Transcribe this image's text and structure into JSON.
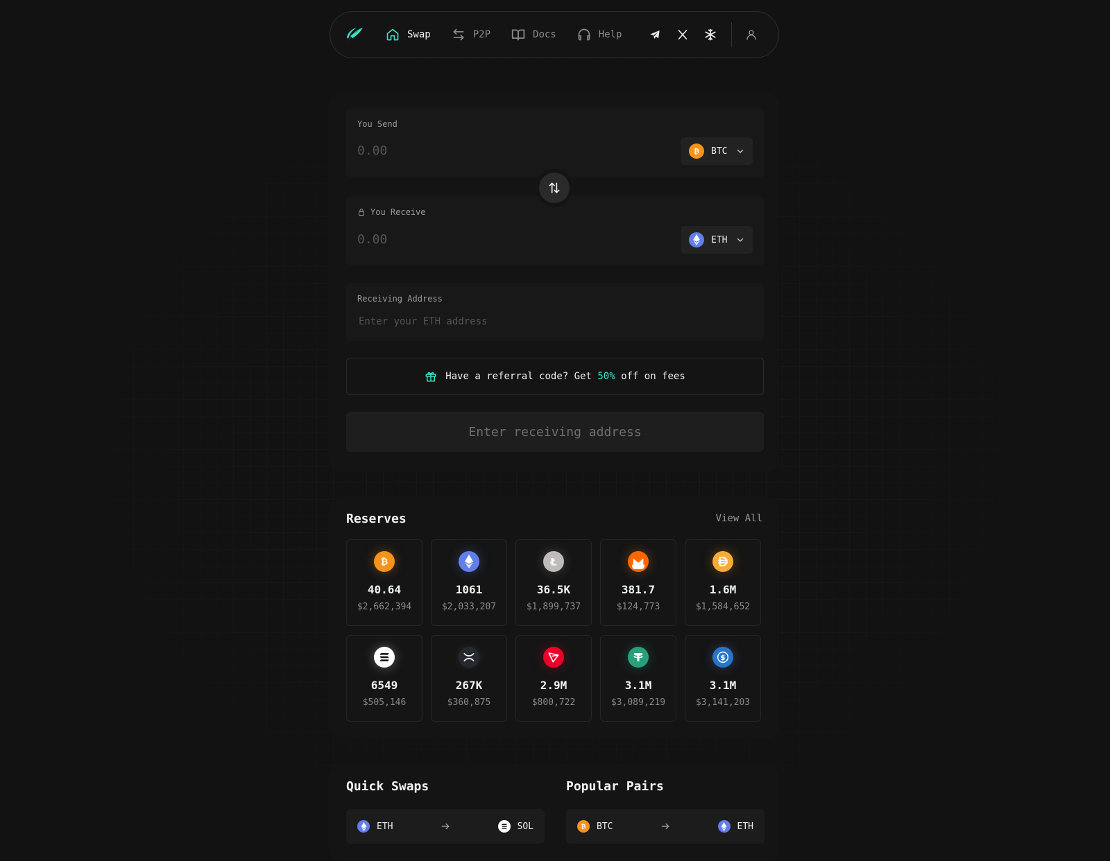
{
  "nav": {
    "items": [
      {
        "label": "Swap",
        "icon": "home-icon",
        "active": true
      },
      {
        "label": "P2P",
        "icon": "arrows-exchange-icon",
        "active": false
      },
      {
        "label": "Docs",
        "icon": "book-icon",
        "active": false
      },
      {
        "label": "Help",
        "icon": "headphones-icon",
        "active": false
      }
    ],
    "social": [
      "telegram-icon",
      "x-icon",
      "snowflake-icon"
    ]
  },
  "swap": {
    "send_label": "You Send",
    "send_amount": "0.00",
    "send_coin": "BTC",
    "receive_label": "You Receive",
    "receive_amount": "0.00",
    "receive_coin": "ETH",
    "address_label": "Receiving Address",
    "address_placeholder": "Enter your ETH address",
    "referral_prefix": "Have a referral code? Get",
    "referral_highlight": "50%",
    "referral_suffix": "off on fees",
    "submit_label": "Enter receiving address"
  },
  "reserves": {
    "title": "Reserves",
    "view_all": "View All",
    "items": [
      {
        "coin": "BTC",
        "amount": "40.64",
        "usd": "$2,662,394",
        "color": "#f7931a"
      },
      {
        "coin": "ETH",
        "amount": "1061",
        "usd": "$2,033,207",
        "color": "#627eea"
      },
      {
        "coin": "LTC",
        "amount": "36.5K",
        "usd": "$1,899,737",
        "color": "#bfbbbb"
      },
      {
        "coin": "XMR",
        "amount": "381.7",
        "usd": "$124,773",
        "color": "#ff6600"
      },
      {
        "coin": "DAI",
        "amount": "1.6M",
        "usd": "$1,584,652",
        "color": "#f5ac37"
      },
      {
        "coin": "SOL",
        "amount": "6549",
        "usd": "$505,146",
        "color": "#ffffff"
      },
      {
        "coin": "XRP",
        "amount": "267K",
        "usd": "$360,875",
        "color": "#23292f"
      },
      {
        "coin": "TRX",
        "amount": "2.9M",
        "usd": "$800,722",
        "color": "#eb0029"
      },
      {
        "coin": "USDT",
        "amount": "3.1M",
        "usd": "$3,089,219",
        "color": "#26a17b"
      },
      {
        "coin": "USDC",
        "amount": "3.1M",
        "usd": "$3,141,203",
        "color": "#2775ca"
      }
    ]
  },
  "quick_swaps": {
    "title": "Quick Swaps",
    "pair": {
      "from": "ETH",
      "to": "SOL"
    }
  },
  "popular_pairs": {
    "title": "Popular Pairs",
    "pair": {
      "from": "BTC",
      "to": "ETH"
    }
  },
  "colors": {
    "accent": "#3ee0c3",
    "background": "#121212"
  }
}
